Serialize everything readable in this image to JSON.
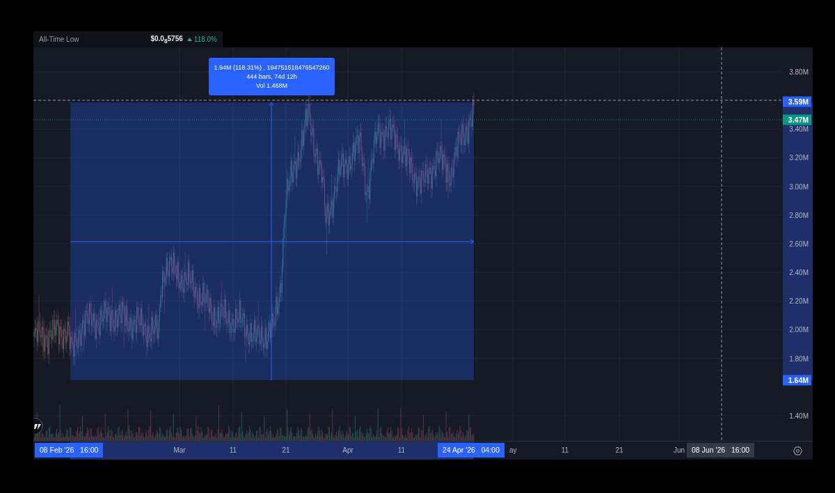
{
  "header": {
    "label": "All-Time Low",
    "price": "$0.0$_{8}$5756",
    "change": "118.0%"
  },
  "measure_tooltip": {
    "lines": [
      "1.94M (118.31%) , 194751518476547260",
      "444 bars, 74d 12h",
      "Vol 1.468M"
    ]
  },
  "price_axis": {
    "ticks": [
      "3.80M",
      "3.40M",
      "3.20M",
      "3.00M",
      "2.80M",
      "2.60M",
      "2.40M",
      "2.20M",
      "2.00M",
      "1.80M",
      "1.40M"
    ]
  },
  "price_labels": [
    {
      "text": "3.59M",
      "kind": "range"
    },
    {
      "text": "3.47M",
      "kind": "last"
    },
    {
      "text": "1.64M",
      "kind": "range"
    }
  ],
  "time_axis": {
    "ticks": [
      "Mar",
      "11",
      "21",
      "Apr",
      "11",
      "ay",
      "11",
      "21",
      "Jun"
    ]
  },
  "time_labels": [
    {
      "text": "08 Feb '26   16:00",
      "kind": "range"
    },
    {
      "text": "24 Apr '26   04:00",
      "kind": "range"
    },
    {
      "text": "08 Jun '26   16:00",
      "kind": "crosshair"
    }
  ]
}
